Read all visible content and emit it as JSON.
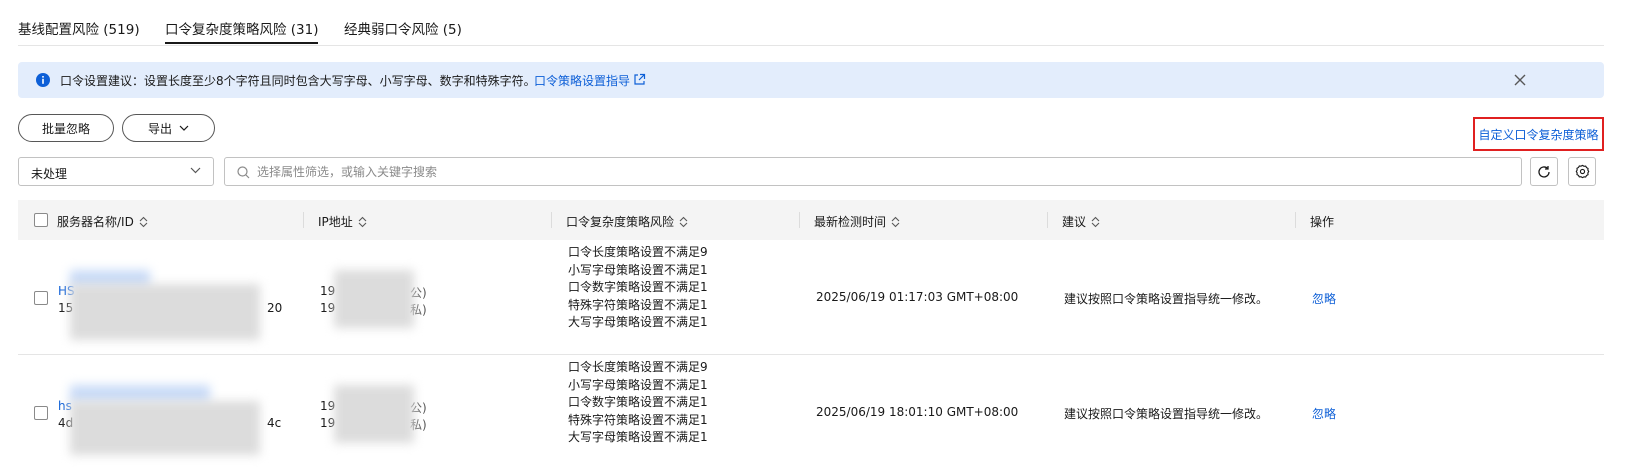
{
  "tabs": [
    {
      "label": "基线配置风险 (519)"
    },
    {
      "label": "口令复杂度策略风险 (31)"
    },
    {
      "label": "经典弱口令风险 (5)"
    }
  ],
  "alert": {
    "message": "口令设置建议：设置长度至少8个字符且同时包含大写字母、小写字母、数字和特殊字符。",
    "link": "口令策略设置指导"
  },
  "toolbar": {
    "ignore_label": "批量忽略",
    "export_label": "导出",
    "custom_policy_label": "自定义口令复杂度策略"
  },
  "filter": {
    "status_value": "未处理",
    "search_placeholder": "选择属性筛选，或输入关键字搜索"
  },
  "table": {
    "columns": [
      "服务器名称/ID",
      "IP地址",
      "口令复杂度策略风险",
      "最新检测时间",
      "建议",
      "操作"
    ],
    "rows": [
      {
        "name": "HS",
        "id_prefix": "15",
        "id_suffix": "20",
        "ip1_prefix": "19",
        "ip1_suffix": "公)",
        "ip2_prefix": "19",
        "ip2_suffix": "私)",
        "risks": [
          "口令长度策略设置不满足9",
          "小写字母策略设置不满足1",
          "口令数字策略设置不满足1",
          "特殊字符策略设置不满足1",
          "大写字母策略设置不满足1"
        ],
        "time": "2025/06/19 01:17:03 GMT+08:00",
        "advice": "建议按照口令策略设置指导统一修改。",
        "action": "忽略"
      },
      {
        "name": "hs",
        "id_prefix": "4d",
        "id_suffix": "4c",
        "ip1_prefix": "19",
        "ip1_suffix": "公)",
        "ip2_prefix": "19",
        "ip2_suffix": "私)",
        "risks": [
          "口令长度策略设置不满足9",
          "小写字母策略设置不满足1",
          "口令数字策略设置不满足1",
          "特殊字符策略设置不满足1",
          "大写字母策略设置不满足1"
        ],
        "time": "2025/06/19 18:01:10 GMT+08:00",
        "advice": "建议按照口令策略设置指导统一修改。",
        "action": "忽略"
      }
    ]
  },
  "colors": {
    "link": "#0d5fd7",
    "alert_bg": "#e3edfc",
    "highlight_border": "#e02020"
  },
  "icons": [
    "info-icon",
    "external-link-icon",
    "close-icon",
    "chevron-down-icon",
    "search-icon",
    "refresh-icon",
    "settings-icon",
    "sort-icon"
  ]
}
